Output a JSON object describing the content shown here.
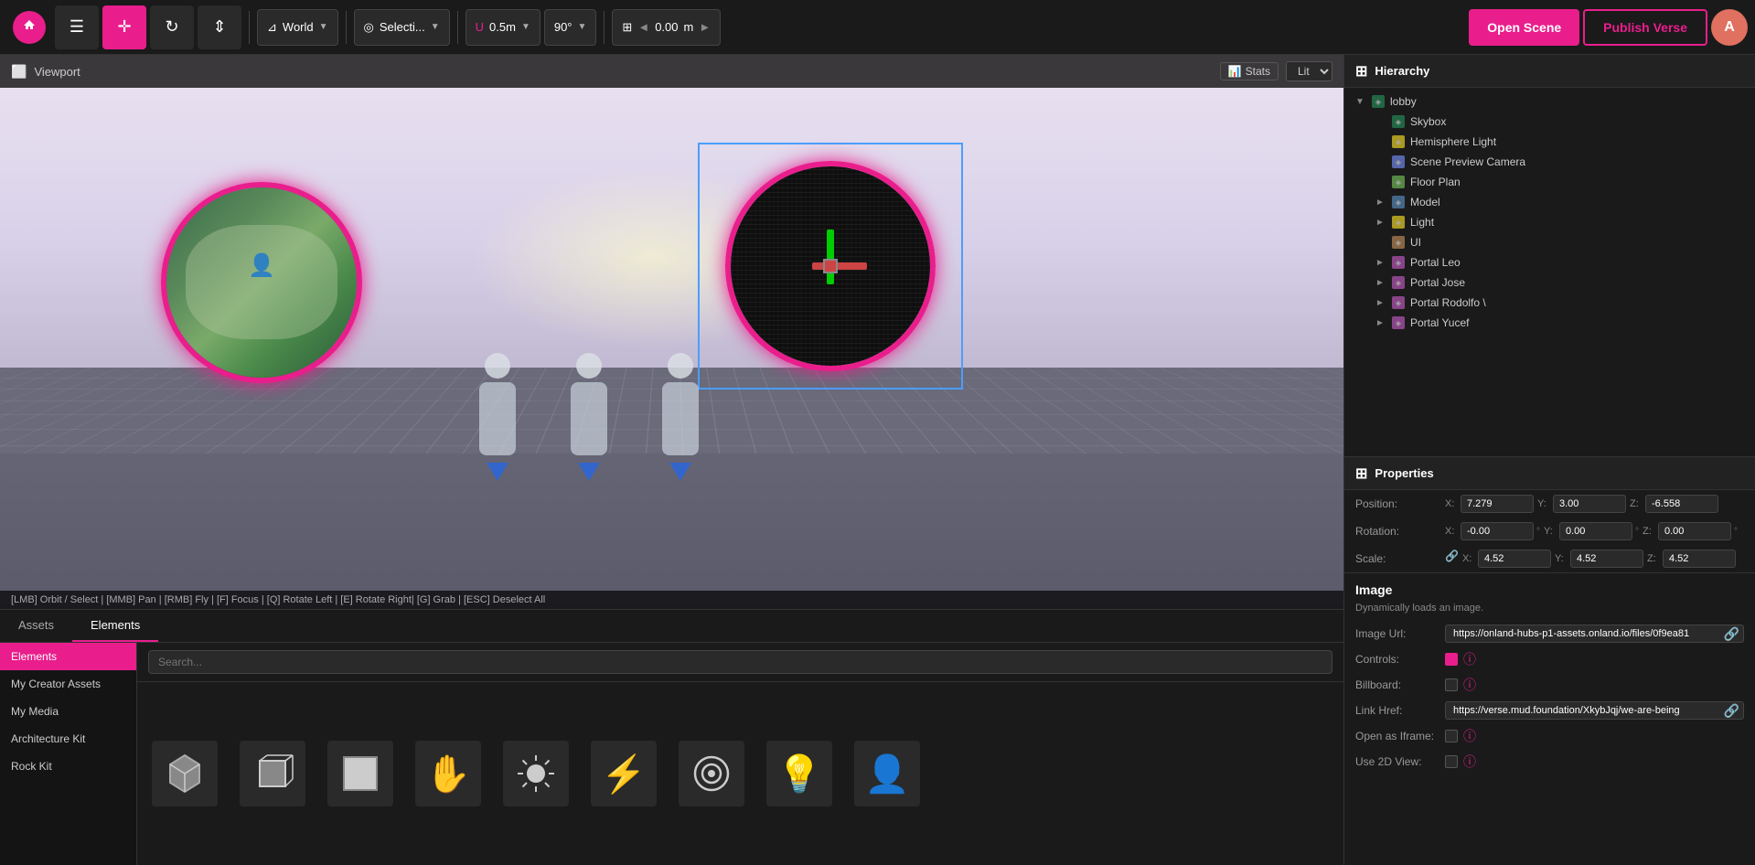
{
  "toolbar": {
    "world_label": "World",
    "selection_label": "Selecti...",
    "snap_label": "0.5m",
    "angle_label": "90°",
    "position_label": "0.00",
    "position_unit": "m",
    "open_scene": "Open Scene",
    "publish_verse": "Publish Verse",
    "avatar_initial": "A"
  },
  "viewport": {
    "title": "Viewport",
    "stats_label": "Stats",
    "lit_label": "Lit",
    "status_bar": "[LMB] Orbit / Select | [MMB] Pan | [RMB] Fly | [F] Focus | [Q] Rotate Left | [E] Rotate Right| [G] Grab | [ESC] Deselect All"
  },
  "hierarchy": {
    "title": "Hierarchy",
    "items": [
      {
        "id": "lobby",
        "label": "lobby",
        "level": 0,
        "expandable": true,
        "expanded": true,
        "icon_type": "scene"
      },
      {
        "id": "skybox",
        "label": "Skybox",
        "level": 1,
        "expandable": false,
        "icon_type": "scene"
      },
      {
        "id": "hemisphere_light",
        "label": "Hemisphere Light",
        "level": 1,
        "expandable": false,
        "icon_type": "light"
      },
      {
        "id": "scene_preview_camera",
        "label": "Scene Preview Camera",
        "level": 1,
        "expandable": false,
        "icon_type": "camera"
      },
      {
        "id": "floor_plan",
        "label": "Floor Plan",
        "level": 1,
        "expandable": false,
        "icon_type": "floor"
      },
      {
        "id": "model",
        "label": "Model",
        "level": 1,
        "expandable": true,
        "expanded": false,
        "icon_type": "model"
      },
      {
        "id": "light",
        "label": "Light",
        "level": 1,
        "expandable": true,
        "expanded": false,
        "icon_type": "light"
      },
      {
        "id": "ui",
        "label": "UI",
        "level": 1,
        "expandable": false,
        "icon_type": "ui-node"
      },
      {
        "id": "portal_leo",
        "label": "Portal Leo",
        "level": 1,
        "expandable": true,
        "expanded": false,
        "icon_type": "portal"
      },
      {
        "id": "portal_jose",
        "label": "Portal Jose",
        "level": 1,
        "expandable": true,
        "expanded": false,
        "icon_type": "portal"
      },
      {
        "id": "portal_rodolfo",
        "label": "Portal Rodolfo \\",
        "level": 1,
        "expandable": true,
        "expanded": false,
        "icon_type": "portal"
      },
      {
        "id": "portal_yucef",
        "label": "Portal Yucef",
        "level": 1,
        "expandable": true,
        "expanded": false,
        "icon_type": "portal"
      }
    ]
  },
  "properties": {
    "title": "Properties",
    "position_label": "Position:",
    "rotation_label": "Rotation:",
    "scale_label": "Scale:",
    "pos_x": "7.279",
    "pos_y": "3.00",
    "pos_z": "-6.558",
    "rot_x": "-0.00",
    "rot_y": "0.00",
    "rot_z": "0.00",
    "scale_x": "4.52",
    "scale_y": "4.52",
    "scale_z": "4.52"
  },
  "image_component": {
    "title": "Image",
    "description": "Dynamically loads an image.",
    "image_url_label": "Image Url:",
    "image_url_value": "https://onland-hubs-p1-assets.onland.io/files/0f9ea81",
    "controls_label": "Controls:",
    "controls_checked": true,
    "billboard_label": "Billboard:",
    "billboard_checked": false,
    "link_href_label": "Link Href:",
    "link_href_value": "https://verse.mud.foundation/XkybJqj/we-are-being",
    "open_as_iframe_label": "Open as Iframe:",
    "open_as_iframe_checked": false,
    "use_2d_view_label": "Use 2D View:",
    "use_2d_view_checked": false
  },
  "assets": {
    "tabs": [
      {
        "id": "assets",
        "label": "Assets"
      },
      {
        "id": "elements",
        "label": "Elements"
      }
    ],
    "active_tab": "elements",
    "sidebar_items": [
      {
        "id": "elements",
        "label": "Elements",
        "active": true
      },
      {
        "id": "my_creator",
        "label": "My Creator Assets"
      },
      {
        "id": "my_media",
        "label": "My Media"
      },
      {
        "id": "architecture",
        "label": "Architecture Kit"
      },
      {
        "id": "rock_kit",
        "label": "Rock Kit"
      }
    ],
    "search_placeholder": "Search...",
    "grid_items": [
      {
        "id": "item1",
        "icon": "⬡",
        "label": ""
      },
      {
        "id": "item2",
        "icon": "⬛",
        "label": ""
      },
      {
        "id": "item3",
        "icon": "⬜",
        "label": ""
      },
      {
        "id": "item4",
        "icon": "✋",
        "label": ""
      },
      {
        "id": "item5",
        "icon": "✳",
        "label": ""
      },
      {
        "id": "item6",
        "icon": "⚡",
        "label": ""
      },
      {
        "id": "item7",
        "icon": "◎",
        "label": ""
      },
      {
        "id": "item8",
        "icon": "💡",
        "label": ""
      },
      {
        "id": "item9",
        "icon": "👤",
        "label": ""
      }
    ]
  }
}
